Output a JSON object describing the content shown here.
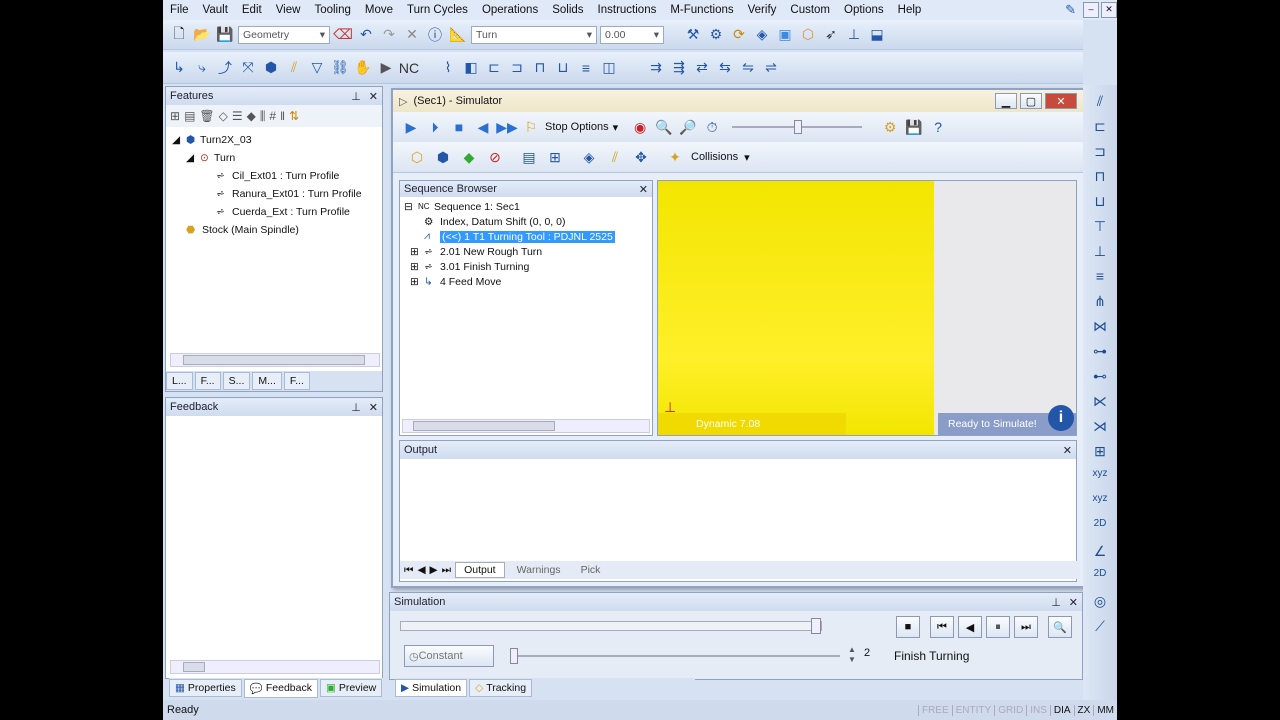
{
  "menu": [
    "File",
    "Vault",
    "Edit",
    "View",
    "Tooling",
    "Move",
    "Turn Cycles",
    "Operations",
    "Solids",
    "Instructions",
    "M-Functions",
    "Verify",
    "Custom",
    "Options",
    "Help"
  ],
  "toolbar": {
    "geometry_combo": "Geometry",
    "turn_combo": "Turn",
    "value_combo": "0.00"
  },
  "features": {
    "title": "Features",
    "items": [
      {
        "label": "Turn2X_03"
      },
      {
        "label": "Turn"
      },
      {
        "label": "Cil_Ext01 :  Turn Profile"
      },
      {
        "label": "Ranura_Ext01 :  Turn Profile"
      },
      {
        "label": "Cuerda_Ext :  Turn Profile"
      },
      {
        "label": "Stock (Main Spindle)"
      }
    ],
    "tabs": [
      "L...",
      "F...",
      "S...",
      "M...",
      "F..."
    ]
  },
  "feedback": {
    "title": "Feedback"
  },
  "simulator": {
    "title": "(Sec1) - Simulator",
    "stop_options": "Stop Options",
    "collisions": "Collisions",
    "sequence_browser": {
      "title": "Sequence Browser",
      "items": [
        {
          "label": "Sequence 1: Sec1"
        },
        {
          "label": "Index, Datum Shift (0, 0, 0)"
        },
        {
          "label": "(<<) 1 T1 Turning Tool : PDJNL 2525"
        },
        {
          "label": "2.01 New Rough Turn"
        },
        {
          "label": "3.01 Finish Turning"
        },
        {
          "label": "4 Feed Move"
        }
      ]
    },
    "viewport": {
      "dynamic_label": "Dynamic 7.08",
      "ready_label": "Ready to Simulate!",
      "yellow": "#f2e600"
    },
    "output": {
      "title": "Output",
      "tabs": [
        "Output",
        "Warnings",
        "Pick"
      ]
    }
  },
  "simulation_panel": {
    "title": "Simulation",
    "constant_label": "Constant",
    "step_value": "2",
    "operation": "Finish Turning"
  },
  "bottom_tabs_left": [
    "Properties",
    "Feedback",
    "Preview"
  ],
  "bottom_tabs_right": [
    "Simulation",
    "Tracking"
  ],
  "status": {
    "text": "Ready",
    "indicators": [
      "FREE",
      "ENTITY",
      "GRID",
      "INS",
      "DIA",
      "ZX",
      "MM"
    ]
  }
}
